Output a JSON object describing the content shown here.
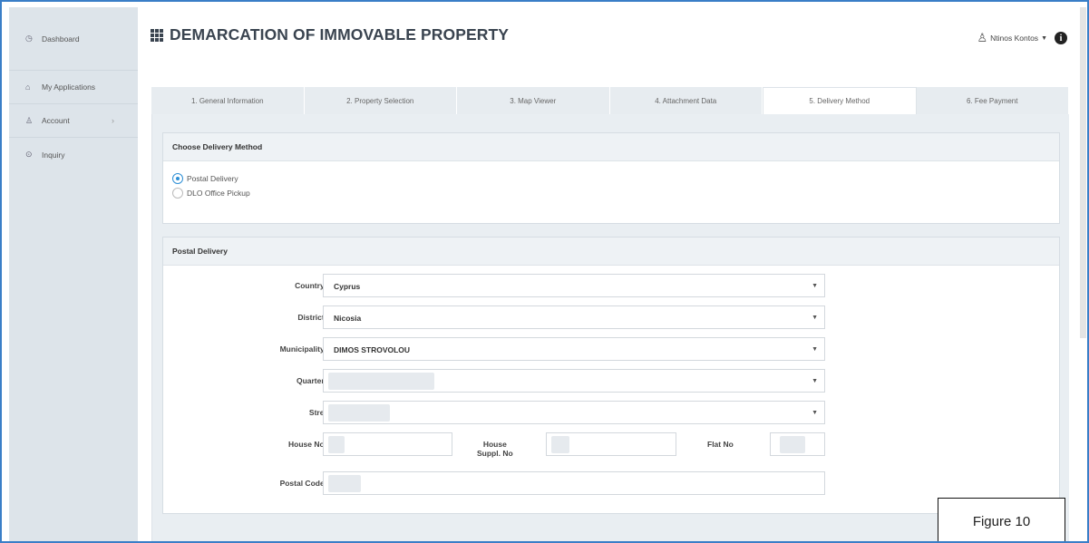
{
  "sidebar": {
    "items": [
      {
        "icon": "clock-icon",
        "glyph": "◷",
        "label": "Dashboard"
      },
      {
        "icon": "bank-icon",
        "glyph": "⌂",
        "label": "My Applications"
      },
      {
        "icon": "user-icon",
        "glyph": "♙",
        "label": "Account",
        "chevron": "›"
      },
      {
        "icon": "question-icon",
        "glyph": "⊙",
        "label": "Inquiry"
      }
    ]
  },
  "header": {
    "title": "DEMARCATION OF IMMOVABLE PROPERTY",
    "user_name": "Ntinos Kontos"
  },
  "tabs": [
    {
      "label": "1. General Information"
    },
    {
      "label": "2. Property Selection"
    },
    {
      "label": "3. Map Viewer"
    },
    {
      "label": "4. Attachment Data"
    },
    {
      "label": "5. Delivery Method",
      "active": true
    },
    {
      "label": "6. Fee Payment"
    }
  ],
  "delivery_method": {
    "heading": "Choose Delivery Method",
    "options": [
      {
        "label": "Postal Delivery",
        "selected": true
      },
      {
        "label": "DLO Office Pickup",
        "selected": false
      }
    ]
  },
  "postal": {
    "heading": "Postal Delivery",
    "country": {
      "label": "Country",
      "required": "*",
      "value": "Cyprus"
    },
    "district": {
      "label": "District",
      "required": "*",
      "value": "Nicosia"
    },
    "municipality": {
      "label": "Municipality",
      "required": "*",
      "value": "DIMOS STROVOLOU"
    },
    "quarter": {
      "label": "Quarter",
      "required": "*",
      "value": ""
    },
    "street": {
      "label": "Street",
      "value": ""
    },
    "house_no": {
      "label": "House No",
      "required": "*"
    },
    "house_suppl": {
      "label_line1": "House",
      "label_line2": "Suppl. No"
    },
    "flat_no": {
      "label": "Flat No"
    },
    "postal_code": {
      "label": "Postal Code",
      "required": "*"
    }
  },
  "figure_label": "Figure 10",
  "colors": {
    "accent": "#2d8fd5",
    "frame": "#3a7ec7",
    "required": "#d33333"
  }
}
